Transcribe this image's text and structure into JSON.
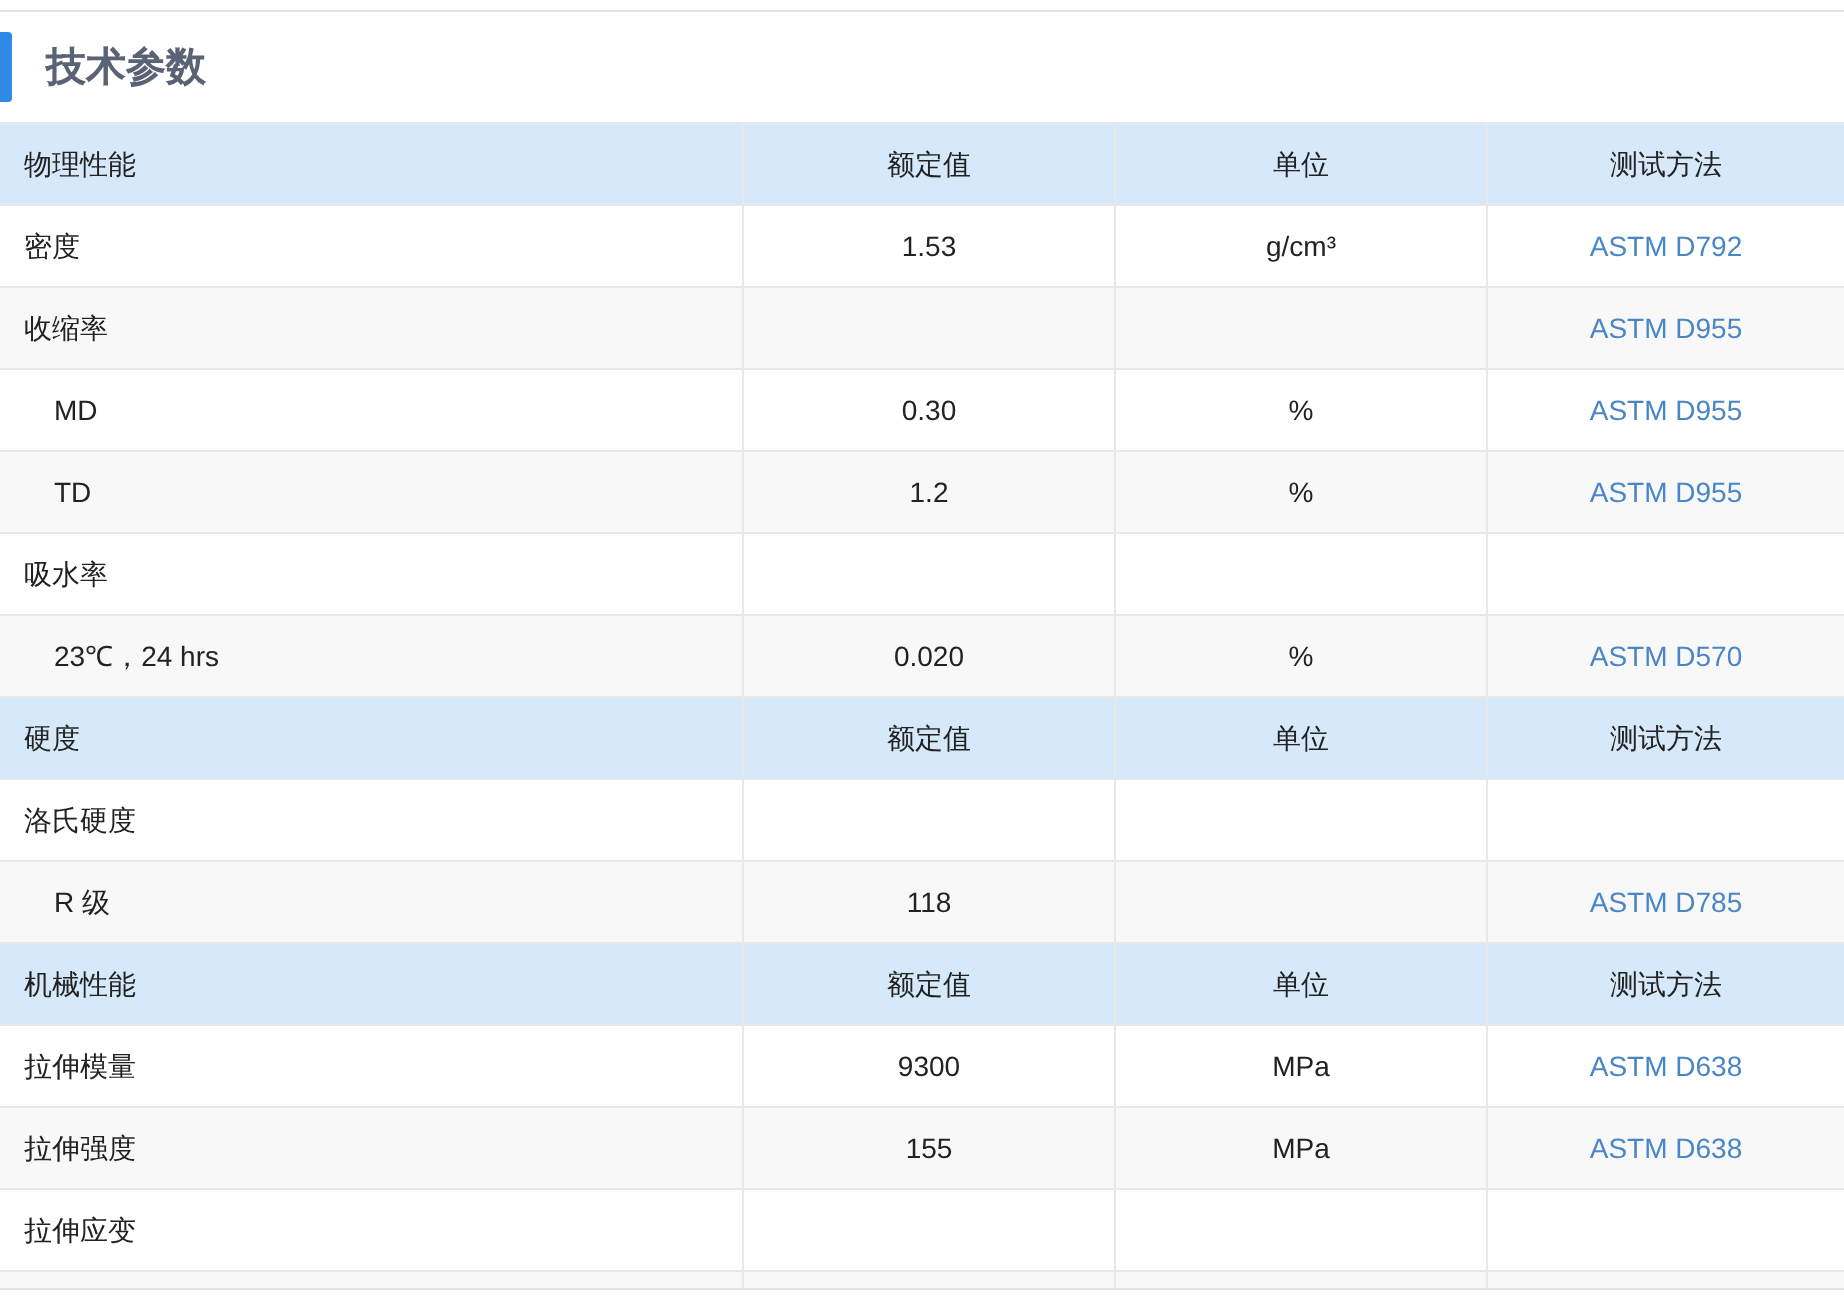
{
  "title": "技术参数",
  "rows": [
    {
      "kind": "header",
      "cells": [
        "物理性能",
        "额定值",
        "单位",
        "测试方法"
      ]
    },
    {
      "kind": "data",
      "indent": false,
      "cells": [
        "密度",
        "1.53",
        "g/cm³",
        "ASTM D792"
      ]
    },
    {
      "kind": "data",
      "indent": false,
      "cells": [
        "收缩率",
        null,
        null,
        "ASTM D955"
      ]
    },
    {
      "kind": "data",
      "indent": true,
      "cells": [
        "MD",
        "0.30",
        "%",
        "ASTM D955"
      ]
    },
    {
      "kind": "data",
      "indent": true,
      "cells": [
        "TD",
        "1.2",
        "%",
        "ASTM D955"
      ]
    },
    {
      "kind": "data",
      "indent": false,
      "cells": [
        "吸水率",
        null,
        null,
        null
      ]
    },
    {
      "kind": "data",
      "indent": true,
      "cells": [
        "23℃，24 hrs",
        "0.020",
        "%",
        "ASTM D570"
      ]
    },
    {
      "kind": "header",
      "cells": [
        "硬度",
        "额定值",
        "单位",
        "测试方法"
      ]
    },
    {
      "kind": "data",
      "indent": false,
      "cells": [
        "洛氏硬度",
        null,
        null,
        null
      ]
    },
    {
      "kind": "data",
      "indent": true,
      "cells": [
        "R 级",
        "118",
        null,
        "ASTM D785"
      ]
    },
    {
      "kind": "header",
      "cells": [
        "机械性能",
        "额定值",
        "单位",
        "测试方法"
      ]
    },
    {
      "kind": "data",
      "indent": false,
      "cells": [
        "拉伸模量",
        "9300",
        "MPa",
        "ASTM D638"
      ]
    },
    {
      "kind": "data",
      "indent": false,
      "cells": [
        "拉伸强度",
        "155",
        "MPa",
        "ASTM D638"
      ]
    },
    {
      "kind": "data",
      "indent": false,
      "cells": [
        "拉伸应变",
        null,
        null,
        null
      ]
    },
    {
      "kind": "data",
      "cells": [
        null,
        null,
        null,
        null
      ]
    }
  ]
}
